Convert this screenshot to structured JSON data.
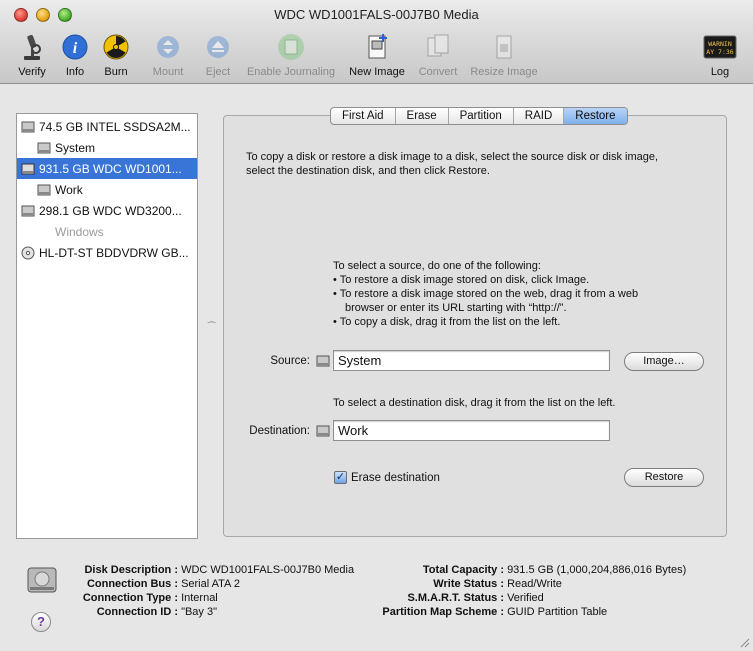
{
  "window": {
    "title": "WDC WD1001FALS-00J7B0 Media"
  },
  "toolbar": {
    "verify": "Verify",
    "info": "Info",
    "burn": "Burn",
    "mount": "Mount",
    "eject": "Eject",
    "enable_journaling": "Enable Journaling",
    "new_image": "New Image",
    "convert": "Convert",
    "resize_image": "Resize Image",
    "log": "Log"
  },
  "sidebar": {
    "items": [
      {
        "label": "74.5 GB INTEL SSDSA2M..."
      },
      {
        "label": "System"
      },
      {
        "label": "931.5 GB WDC WD1001..."
      },
      {
        "label": "Work"
      },
      {
        "label": "298.1 GB WDC WD3200..."
      },
      {
        "label": "Windows"
      },
      {
        "label": "HL-DT-ST BDDVDRW GB..."
      }
    ]
  },
  "tabs": [
    "First Aid",
    "Erase",
    "Partition",
    "RAID",
    "Restore"
  ],
  "restore": {
    "intro_line1": "To copy a disk or restore a disk image to a disk, select the source disk or disk image,",
    "intro_line2": "select the destination disk, and then click Restore.",
    "source_help_title": "To select a source, do one of the following:",
    "source_help_1": "• To restore a disk image stored on disk, click Image.",
    "source_help_2a": "• To restore a disk image stored on the web, drag it from a web",
    "source_help_2b": "browser or enter its URL starting with “http://”.",
    "source_help_3": "• To copy a disk, drag it from the list on the left.",
    "source_label": "Source:",
    "source_value": "System",
    "image_button": "Image…",
    "dest_help": "To select a destination disk, drag it from the list on the left.",
    "dest_label": "Destination:",
    "dest_value": "Work",
    "erase_dest_label": "Erase destination",
    "restore_button": "Restore"
  },
  "info": {
    "disk_description_k": "Disk Description :",
    "disk_description_v": "WDC WD1001FALS-00J7B0 Media",
    "connection_bus_k": "Connection Bus :",
    "connection_bus_v": "Serial ATA 2",
    "connection_type_k": "Connection Type :",
    "connection_type_v": "Internal",
    "connection_id_k": "Connection ID :",
    "connection_id_v": "\"Bay 3\"",
    "total_capacity_k": "Total Capacity :",
    "total_capacity_v": "931.5 GB (1,000,204,886,016 Bytes)",
    "write_status_k": "Write Status :",
    "write_status_v": "Read/Write",
    "smart_status_k": "S.M.A.R.T. Status :",
    "smart_status_v": "Verified",
    "partition_map_k": "Partition Map Scheme :",
    "partition_map_v": "GUID Partition Table"
  },
  "help": {
    "glyph": "?"
  },
  "log_icon_text": {
    "line1": "WARNIN",
    "line2": "AY 7:36"
  }
}
